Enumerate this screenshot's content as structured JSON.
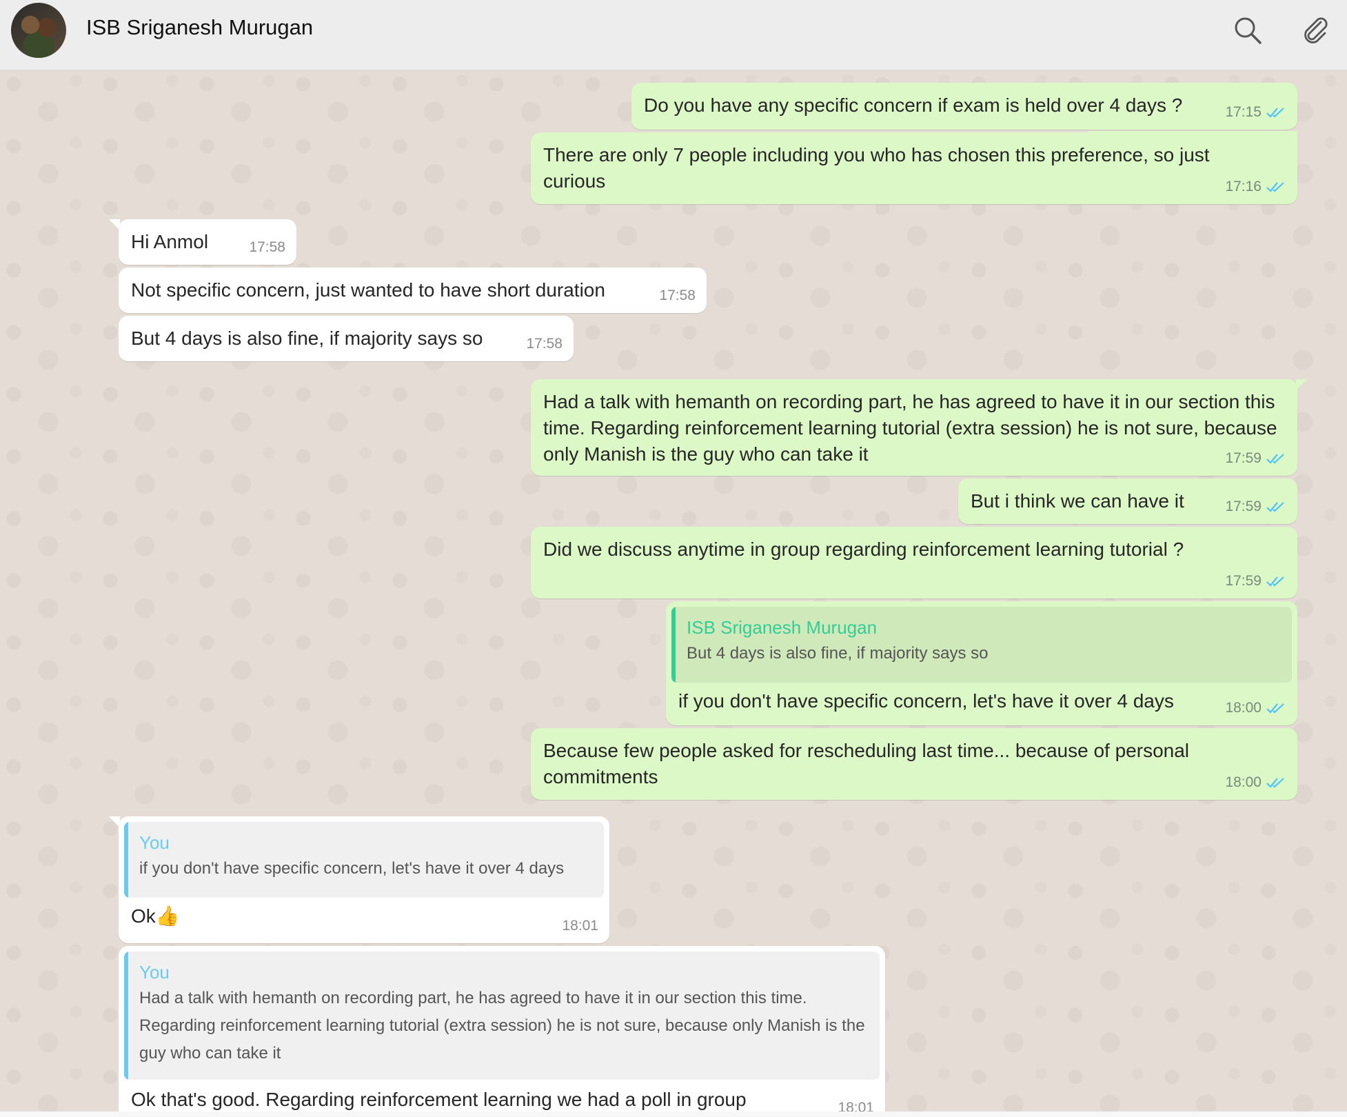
{
  "header": {
    "contact_name": "ISB Sriganesh Murugan",
    "icons": [
      "search-icon",
      "paperclip-icon"
    ]
  },
  "colors": {
    "outgoing_bubble": "#dcf8c6",
    "incoming_bubble": "#ffffff",
    "read_ticks": "#4fc3f7",
    "quote_bar_outgoing": "#35cd96",
    "quote_bar_incoming": "#6bcbef"
  },
  "messages": [
    {
      "text": "Do you have any specific concern if exam is held over 4 days ?",
      "time": "17:15"
    },
    {
      "text": "There are only 7 people including you who has chosen this preference, so just curious",
      "time": "17:16"
    },
    {
      "text": "Hi Anmol",
      "time": "17:58"
    },
    {
      "text": "Not specific concern, just wanted to have short duration",
      "time": "17:58"
    },
    {
      "text": "But 4 days is also fine, if majority says so",
      "time": "17:58"
    },
    {
      "text": "Had a talk with hemanth on recording part, he has agreed to have it in our section this time. Regarding reinforcement learning tutorial (extra session)  he is not sure, because only Manish is the guy who can take it",
      "time": "17:59"
    },
    {
      "text": "But i think we can have it",
      "time": "17:59"
    },
    {
      "text": "Did we discuss anytime in group regarding reinforcement learning tutorial ?",
      "time": "17:59"
    },
    {
      "quote_author": "ISB Sriganesh Murugan",
      "quote_text": "But 4 days is also fine, if majority says so",
      "text": "if you don't have specific concern, let's have it over 4 days",
      "time": "18:00"
    },
    {
      "text": "Because few people asked for rescheduling last time... because of personal commitments",
      "time": "18:00"
    },
    {
      "quote_author": "You",
      "quote_text": "if you don't have specific concern, let's have it over 4 days",
      "text": "Ok👍",
      "time": "18:01"
    },
    {
      "quote_author": "You",
      "quote_text": "Had a talk with hemanth on recording part, he has agreed to have it in our section this time. Regarding reinforcement learning tutorial (extra session)  he is not sure, because only Manish is the guy who can take it",
      "text": "Ok that's good. Regarding reinforcement learning we had a poll in group",
      "time": "18:01"
    }
  ]
}
